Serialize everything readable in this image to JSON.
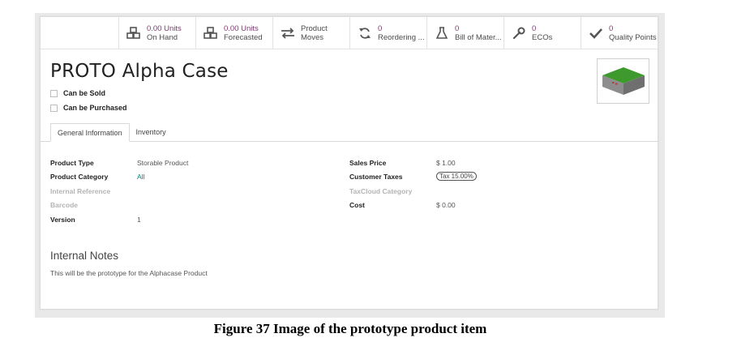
{
  "smart_buttons": [
    {
      "name": "on-hand-button",
      "icon": "cubes-icon",
      "value": "0.00 Units",
      "label": "On Hand"
    },
    {
      "name": "forecasted-button",
      "icon": "cubes-icon",
      "value": "0.00 Units",
      "label": "Forecasted"
    },
    {
      "name": "product-moves-button",
      "icon": "exchange-arrows-icon",
      "value": "Product",
      "label": "Moves"
    },
    {
      "name": "reordering-button",
      "icon": "refresh-icon",
      "value": "0",
      "label": "Reordering ..."
    },
    {
      "name": "bom-button",
      "icon": "flask-icon",
      "value": "0",
      "label": "Bill of Mater..."
    },
    {
      "name": "ecos-button",
      "icon": "wrench-icon",
      "value": "0",
      "label": "ECOs"
    },
    {
      "name": "quality-points-button",
      "icon": "check-icon",
      "value": "0",
      "label": "Quality Points"
    }
  ],
  "product": {
    "name": "PROTO Alpha Case",
    "can_be_sold_label": "Can be Sold",
    "can_be_purchased_label": "Can be Purchased"
  },
  "tabs": [
    "General Information",
    "Inventory"
  ],
  "left_fields": {
    "product_type": {
      "label": "Product Type",
      "value": "Storable Product"
    },
    "product_category": {
      "label": "Product Category",
      "value": "All"
    },
    "internal_reference": {
      "label": "Internal Reference",
      "value": ""
    },
    "barcode": {
      "label": "Barcode",
      "value": ""
    },
    "version": {
      "label": "Version",
      "value": "1"
    }
  },
  "right_fields": {
    "sales_price": {
      "label": "Sales Price",
      "value": "$ 1.00"
    },
    "customer_taxes": {
      "label": "Customer Taxes",
      "value": "Tax 15.00%"
    },
    "taxcloud_category": {
      "label": "TaxCloud Category",
      "value": ""
    },
    "cost": {
      "label": "Cost",
      "value": "$ 0.00"
    }
  },
  "notes": {
    "title": "Internal Notes",
    "text": "This will be the prototype for the Alphacase Product"
  },
  "caption": "Figure 37 Image of the prototype product item",
  "colors": {
    "value_purple": "#7c3a6e",
    "link_teal": "#017e84",
    "tile_green": "#3f9a2e"
  }
}
